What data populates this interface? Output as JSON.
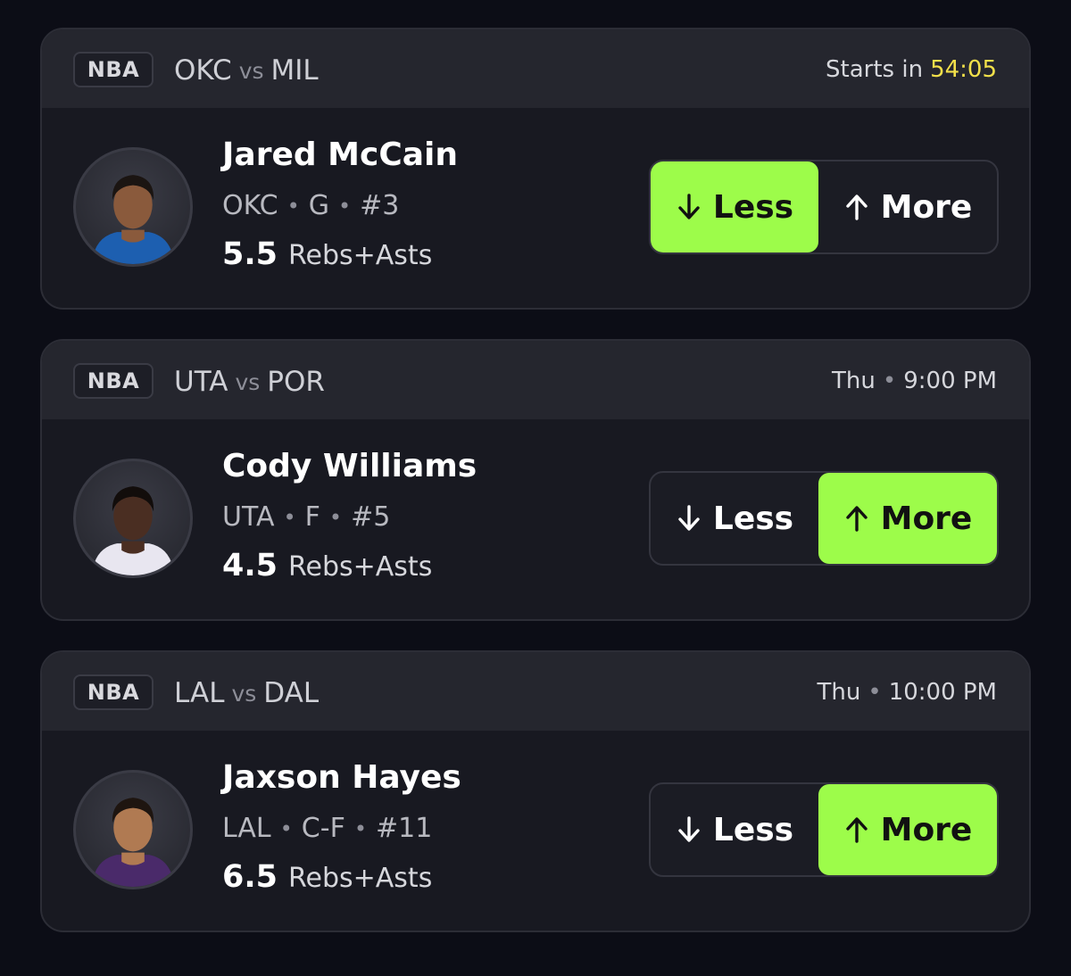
{
  "colors": {
    "background": "#0c0d16",
    "card": "#181921",
    "card_header": "#25262e",
    "accent_selected": "#9dfc4a",
    "countdown": "#f2e04a"
  },
  "cards": [
    {
      "league": "NBA",
      "team_home": "OKC",
      "vs": "vs",
      "team_away": "MIL",
      "time_prefix": "Starts in",
      "time_value": "54:05",
      "player": {
        "name": "Jared McCain",
        "team": "OKC",
        "position": "G",
        "number": "#3",
        "line": "5.5",
        "stat": "Rebs+Asts",
        "jersey_color": "#1d5fb0",
        "skin_color": "#8a5a3c",
        "hair_color": "#1b1512"
      },
      "less_label": "Less",
      "more_label": "More",
      "selected": "less"
    },
    {
      "league": "NBA",
      "team_home": "UTA",
      "vs": "vs",
      "team_away": "POR",
      "time_day": "Thu",
      "time_sep": "•",
      "time_value": "9:00 PM",
      "player": {
        "name": "Cody Williams",
        "team": "UTA",
        "position": "F",
        "number": "#5",
        "line": "4.5",
        "stat": "Rebs+Asts",
        "jersey_color": "#e8e6f0",
        "skin_color": "#4a2e22",
        "hair_color": "#120d0b"
      },
      "less_label": "Less",
      "more_label": "More",
      "selected": "more"
    },
    {
      "league": "NBA",
      "team_home": "LAL",
      "vs": "vs",
      "team_away": "DAL",
      "time_day": "Thu",
      "time_sep": "•",
      "time_value": "10:00 PM",
      "player": {
        "name": "Jaxson Hayes",
        "team": "LAL",
        "position": "C-F",
        "number": "#11",
        "line": "6.5",
        "stat": "Rebs+Asts",
        "jersey_color": "#4a2a6a",
        "skin_color": "#b07a52",
        "hair_color": "#1e1510"
      },
      "less_label": "Less",
      "more_label": "More",
      "selected": "more"
    }
  ]
}
